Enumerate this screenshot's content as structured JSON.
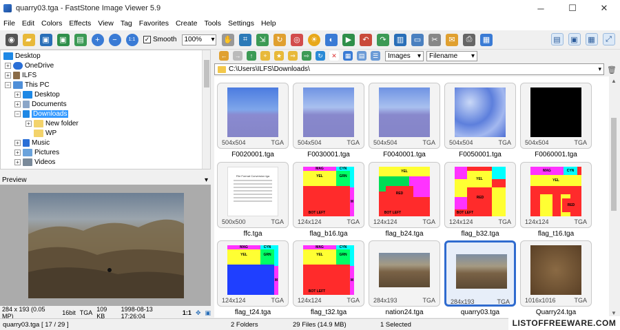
{
  "window": {
    "title": "quarry03.tga - FastStone Image Viewer 5.9",
    "min": "─",
    "max": "☐",
    "close": "✕"
  },
  "menu": [
    "File",
    "Edit",
    "Colors",
    "Effects",
    "View",
    "Tag",
    "Favorites",
    "Create",
    "Tools",
    "Settings",
    "Help"
  ],
  "toolbar": {
    "smooth_label": "Smooth",
    "smooth_checked": "✓",
    "zoom_value": "100%",
    "dd": "▾"
  },
  "tree": {
    "items": [
      {
        "label": "Desktop",
        "exp": "",
        "indent": 0,
        "color": "#1e88e5"
      },
      {
        "label": "OneDrive",
        "exp": "+",
        "indent": 1,
        "color": "#2a6fd6"
      },
      {
        "label": "ILFS",
        "exp": "+",
        "indent": 1,
        "color": "#8a6b47"
      },
      {
        "label": "This PC",
        "exp": "−",
        "indent": 1,
        "color": "#4f8fd8"
      },
      {
        "label": "Desktop",
        "exp": "+",
        "indent": 2,
        "color": "#1e88e5"
      },
      {
        "label": "Documents",
        "exp": "+",
        "indent": 2,
        "color": "#8ba6c8"
      },
      {
        "label": "Downloads",
        "exp": "−",
        "indent": 2,
        "color": "#1e88e5",
        "selected": true
      },
      {
        "label": "New folder",
        "exp": "+",
        "indent": 3,
        "color": "#f3d36b"
      },
      {
        "label": "WP",
        "exp": "",
        "indent": 3,
        "color": "#f3d36b"
      },
      {
        "label": "Music",
        "exp": "+",
        "indent": 2,
        "color": "#2a6fd6"
      },
      {
        "label": "Pictures",
        "exp": "+",
        "indent": 2,
        "color": "#6aa3dc"
      },
      {
        "label": "Videos",
        "exp": "+",
        "indent": 2,
        "color": "#7a8a9a"
      }
    ]
  },
  "preview": {
    "title": "Preview",
    "collapse": "▾",
    "info": {
      "dims": "284 x 193 (0.05 MP)",
      "depth": "16bit",
      "format": "TGA",
      "size": "109 KB",
      "date": "1998-08-13 17:26:04",
      "ratio": "1:1"
    }
  },
  "nav": {
    "filter_value": "Images",
    "sort_value": "Filename",
    "path": "C:\\Users\\ILFS\\Downloads\\",
    "dd": "▾"
  },
  "thumbnails": [
    {
      "name": "F0020001.tga",
      "dims": "504x504",
      "fmt": "TGA",
      "kind": "sky1"
    },
    {
      "name": "F0030001.tga",
      "dims": "504x504",
      "fmt": "TGA",
      "kind": "sky2"
    },
    {
      "name": "F0040001.tga",
      "dims": "504x504",
      "fmt": "TGA",
      "kind": "sky2"
    },
    {
      "name": "F0050001.tga",
      "dims": "504x504",
      "fmt": "TGA",
      "kind": "sky3"
    },
    {
      "name": "F0060001.tga",
      "dims": "504x504",
      "fmt": "TGA",
      "kind": "black"
    },
    {
      "name": "ffc.tga",
      "dims": "500x500",
      "fmt": "TGA",
      "kind": "doc",
      "doc_title": "File Format Conversion tga"
    },
    {
      "name": "flag_b16.tga",
      "dims": "124x124",
      "fmt": "TGA",
      "kind": "flag1"
    },
    {
      "name": "flag_b24.tga",
      "dims": "124x124",
      "fmt": "TGA",
      "kind": "flag2"
    },
    {
      "name": "flag_b32.tga",
      "dims": "124x124",
      "fmt": "TGA",
      "kind": "flag3"
    },
    {
      "name": "flag_t16.tga",
      "dims": "124x124",
      "fmt": "TGA",
      "kind": "flag4"
    },
    {
      "name": "flag_t24.tga",
      "dims": "124x124",
      "fmt": "TGA",
      "kind": "flag5"
    },
    {
      "name": "flag_t32.tga",
      "dims": "124x124",
      "fmt": "TGA",
      "kind": "flag1"
    },
    {
      "name": "nation24.tga",
      "dims": "284x193",
      "fmt": "TGA",
      "kind": "land"
    },
    {
      "name": "quarry03.tga",
      "dims": "284x193",
      "fmt": "TGA",
      "kind": "land",
      "selected": true
    },
    {
      "name": "Quarry24.tga",
      "dims": "1016x1016",
      "fmt": "TGA",
      "kind": "quarry"
    }
  ],
  "flag_labels": {
    "mag": "MAG",
    "cyn": "CYN",
    "yel": "YEL",
    "grn": "GRN",
    "c": "C",
    "red": "RED",
    "m": "M",
    "bot_left": "BOT LEFT"
  },
  "status": {
    "file": "quarry03.tga [ 17 / 29 ]",
    "folders": "2 Folders",
    "files": "29 Files (14.9 MB)",
    "selected": "1 Selected"
  },
  "watermark": "LISTOFFREEWARE.COM"
}
